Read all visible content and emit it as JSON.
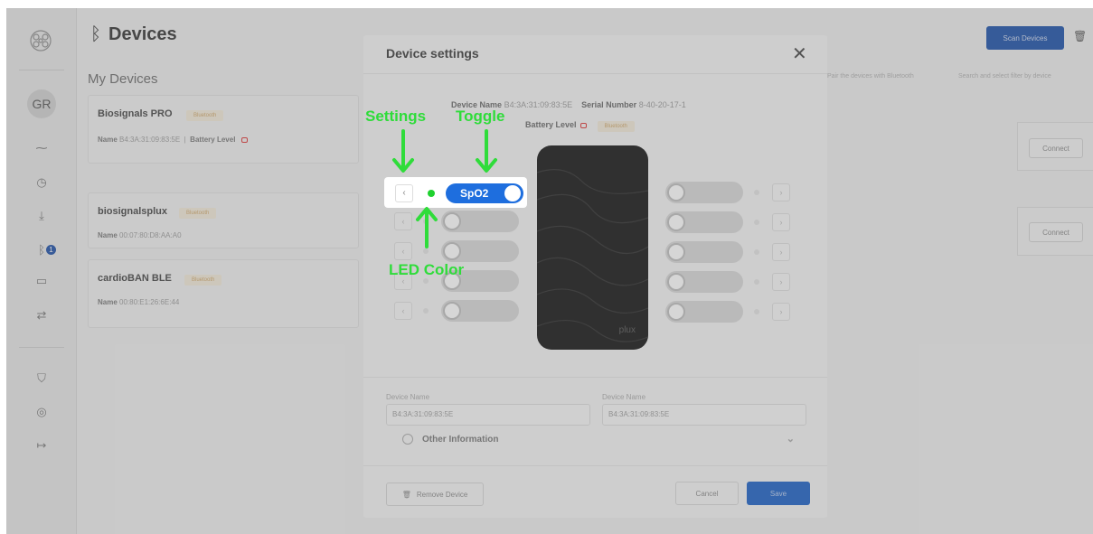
{
  "app": {
    "sidebar": {
      "avatar_initials": "GR",
      "icons": [
        "logo-icon",
        "pulse-icon",
        "timer-icon",
        "download-icon",
        "bluetooth-icon",
        "folder-icon",
        "transfer-icon",
        "cart-icon",
        "help-icon",
        "logout-icon"
      ],
      "notification_count": "1"
    },
    "header": {
      "title_icon": "bluetooth-icon",
      "title": "Devices",
      "scan_label": "Scan Devices"
    },
    "section_title": "My Devices",
    "hints": [
      "Pair the devices with Bluetooth",
      "Search and select filter by device"
    ],
    "devices": [
      {
        "name": "Biosignals PRO",
        "tag": "Bluetooth",
        "name_label": "Name",
        "address": "B4:3A:31:09:83:5E",
        "battery_label": "Battery Level"
      },
      {
        "name": "biosignalsplux",
        "tag": "Bluetooth",
        "name_label": "Name",
        "address": "00:07:80:D8:AA:A0"
      },
      {
        "name": "cardioBAN BLE",
        "tag": "Bluetooth",
        "name_label": "Name",
        "address": "00:80:E1:26:6E:44"
      }
    ],
    "connect_label": "Connect"
  },
  "modal": {
    "title": "Device settings",
    "device_name_label": "Device Name",
    "device_name_value": "B4:3A:31:09:83:5E",
    "serial_label": "Serial Number",
    "serial_value": "8-40-20-17-1",
    "battery_label": "Battery Level",
    "battery_tag": "Bluetooth",
    "device_logo": "plux",
    "highlight_channel": {
      "label": "SpO2",
      "led_color": "#1fd12f",
      "enabled": true
    },
    "fields": [
      {
        "label": "Device Name",
        "value": "B4:3A:31:09:83:5E"
      },
      {
        "label": "Device Name",
        "value": "B4:3A:31:09:83:5E"
      }
    ],
    "other_info_label": "Other Information",
    "remove_label": "Remove Device",
    "cancel_label": "Cancel",
    "save_label": "Save"
  },
  "annotations": {
    "settings": "Settings",
    "toggle": "Toggle",
    "led_color": "LED Color",
    "color": "#2fdc3a"
  }
}
